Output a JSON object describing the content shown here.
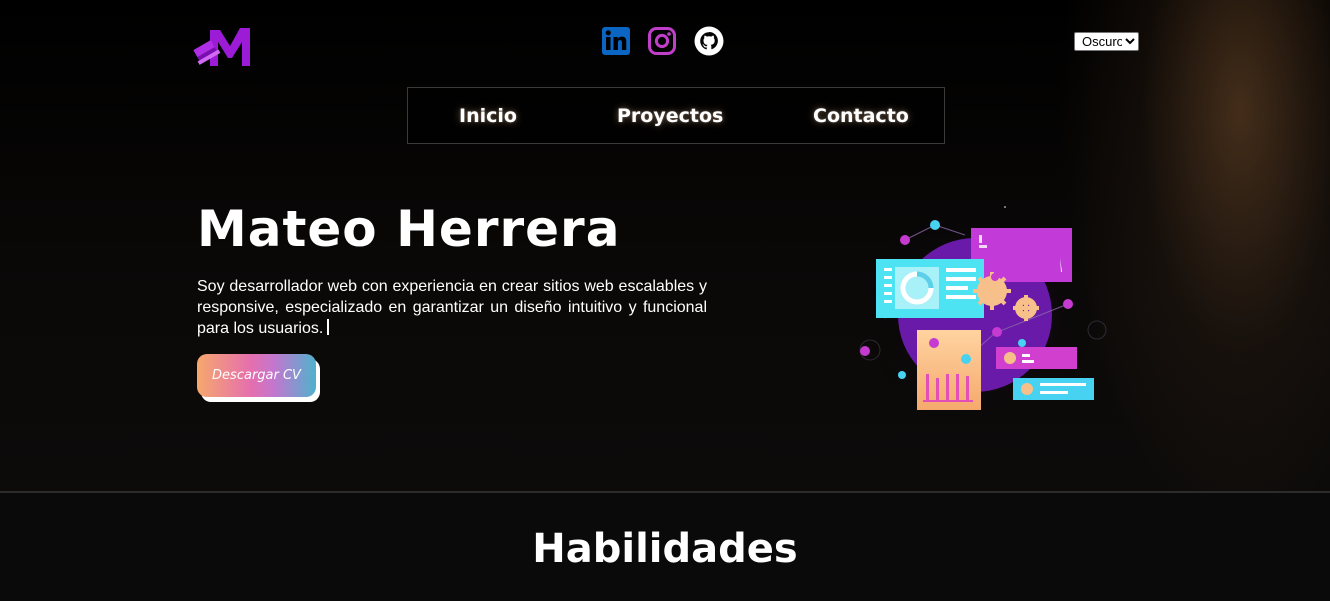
{
  "header": {
    "logo_icon": "brand-logo-icon",
    "social": [
      {
        "name": "LinkedIn",
        "icon": "linkedin-icon",
        "color": "#0a66c2"
      },
      {
        "name": "Instagram",
        "icon": "instagram-icon",
        "color": "#c13ec9"
      },
      {
        "name": "GitHub",
        "icon": "github-icon",
        "color": "#ffffff"
      }
    ],
    "theme_select": {
      "selected": "Oscuro",
      "options": [
        "Oscuro"
      ]
    }
  },
  "nav": {
    "items": [
      {
        "label": "Inicio"
      },
      {
        "label": "Proyectos"
      },
      {
        "label": "Contacto"
      }
    ]
  },
  "hero": {
    "title": "Mateo Herrera",
    "description": "Soy desarrollador web con experiencia en crear sitios web escalables y responsive, especializado en garantizar un diseño intuitivo y funcional para los usuarios.",
    "cv_button": "Descargar CV",
    "illustration_icon": "dashboard-illustration"
  },
  "skills": {
    "title": "Habilidades"
  },
  "colors": {
    "brand": "#9b1bd6",
    "background": "#050505",
    "text": "#ffffff",
    "cv_gradient": [
      "#f6a86d",
      "#e56fae",
      "#4fb2cd"
    ]
  }
}
